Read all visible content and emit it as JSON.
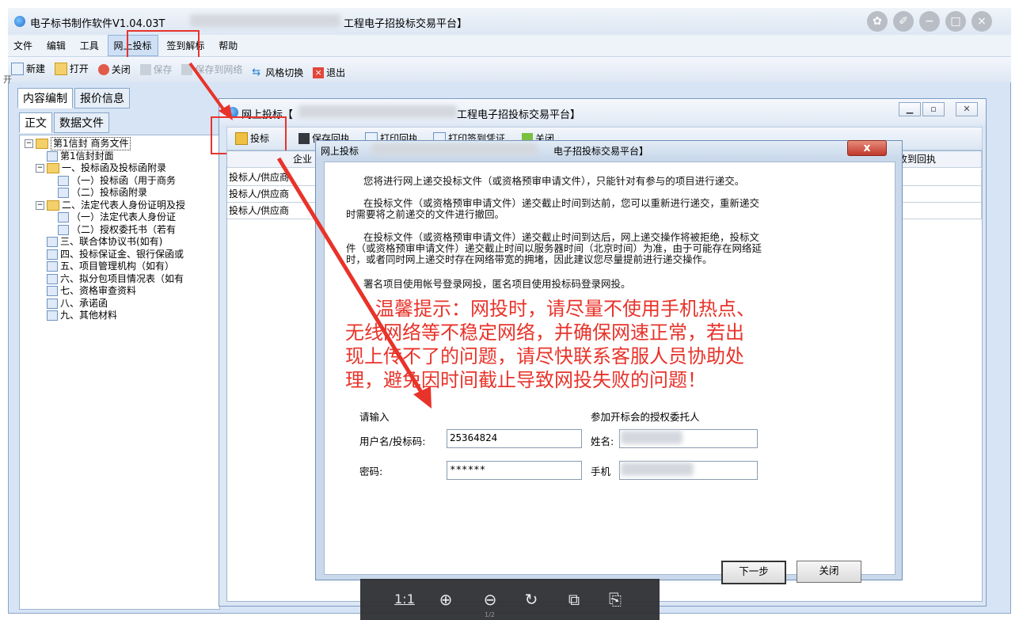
{
  "main": {
    "title": "电子标书制作软件V1.04.03T",
    "title_suffix": "工程电子招投标交易平台】",
    "menu": [
      "文件",
      "编辑",
      "工具",
      "网上投标",
      "签到解标",
      "帮助"
    ],
    "toolbar": [
      "新建",
      "打开",
      "关闭",
      "保存",
      "保存到网络",
      "风格切换",
      "退出"
    ],
    "tabs_top": [
      "内容编制",
      "报价信息"
    ],
    "tabs_sub": [
      "正文",
      "数据文件"
    ],
    "side_glyph": "开"
  },
  "tree": [
    {
      "label": "第1信封 商务文件",
      "level": 0,
      "type": "folder",
      "expander": "−"
    },
    {
      "label": "第1信封封面",
      "level": 1,
      "type": "node"
    },
    {
      "label": "一、投标函及投标函附录",
      "level": 1,
      "type": "folder",
      "expander": "−"
    },
    {
      "label": "（一）投标函（用于商务",
      "level": 2,
      "type": "node"
    },
    {
      "label": "（二）投标函附录",
      "level": 2,
      "type": "node"
    },
    {
      "label": "二、法定代表人身份证明及授",
      "level": 1,
      "type": "folder",
      "expander": "−"
    },
    {
      "label": "（一）法定代表人身份证",
      "level": 2,
      "type": "node"
    },
    {
      "label": "（二）授权委托书（若有",
      "level": 2,
      "type": "node"
    },
    {
      "label": "三、联合体协议书(如有)",
      "level": 1,
      "type": "node"
    },
    {
      "label": "四、投标保证金、银行保函或",
      "level": 1,
      "type": "node"
    },
    {
      "label": "五、项目管理机构（如有）",
      "level": 1,
      "type": "node"
    },
    {
      "label": "六、拟分包项目情况表（如有",
      "level": 1,
      "type": "node"
    },
    {
      "label": "七、资格审查资料",
      "level": 1,
      "type": "node"
    },
    {
      "label": "八、承诺函",
      "level": 1,
      "type": "node"
    },
    {
      "label": "九、其他材料",
      "level": 1,
      "type": "node"
    }
  ],
  "bid_window": {
    "title": "网上投标【",
    "title_suffix": "工程电子招投标交易平台】",
    "toolbar": [
      "投标",
      "保存回执",
      "打印回执",
      "打印签到凭证",
      "关闭"
    ],
    "header_left": "企业",
    "header_right": "收到回执",
    "rows": [
      "投标人/供应商",
      "投标人/供应商",
      "投标人/供应商"
    ]
  },
  "dialog": {
    "title": "网上投标",
    "title_suffix": "电子招投标交易平台】",
    "close_glyph": "x",
    "para1": "您将进行网上递交投标文件（或资格预审申请文件），只能针对有参与的项目进行递交。",
    "para2_line1": "在投标文件（或资格预审申请文件）递交截止时间到达前，您可以重新进行递交，重新递交",
    "para2_line2": "时需要将之前递交的文件进行撤回。",
    "para3_line1": "在投标文件（或资格预审申请文件）递交截止时间到达后，网上递交操作将被拒绝，投标文",
    "para3_line2": "件（或资格预审申请文件）递交截止时间以服务器时间（北京时间）为准，由于可能存在网络延",
    "para3_line3": "时，或者同时网上递交时存在网络带宽的拥堵，因此建议您尽量提前进行递交操作。",
    "para4": "署名项目使用帐号登录网投，匿名项目使用投标码登录网投。",
    "warning_lines": [
      "温馨提示：网投时，请尽量不使用手机热点、",
      "无线网络等不稳定网络，并确保网速正常，若出",
      "现上传不了的问题，请尽快联系客服人员协助处",
      "理，避免因时间截止导致网投失败的问题！"
    ],
    "input_heading": "请输入",
    "delegate_heading": "参加开标会的授权委托人",
    "username_label": "用户名/投标码:",
    "username_value": "25364824",
    "password_label": "密码:",
    "password_value": "******",
    "name_label": "姓名:",
    "phone_label": "手机",
    "next_button": "下一步",
    "close_button": "关闭"
  },
  "viewer": {
    "ratio_label": "1:1",
    "page_hint": "1/2"
  },
  "colors": {
    "warning_text": "#e8332a",
    "annotation": "#e8332a",
    "window_bg": "#d6e4f5"
  }
}
